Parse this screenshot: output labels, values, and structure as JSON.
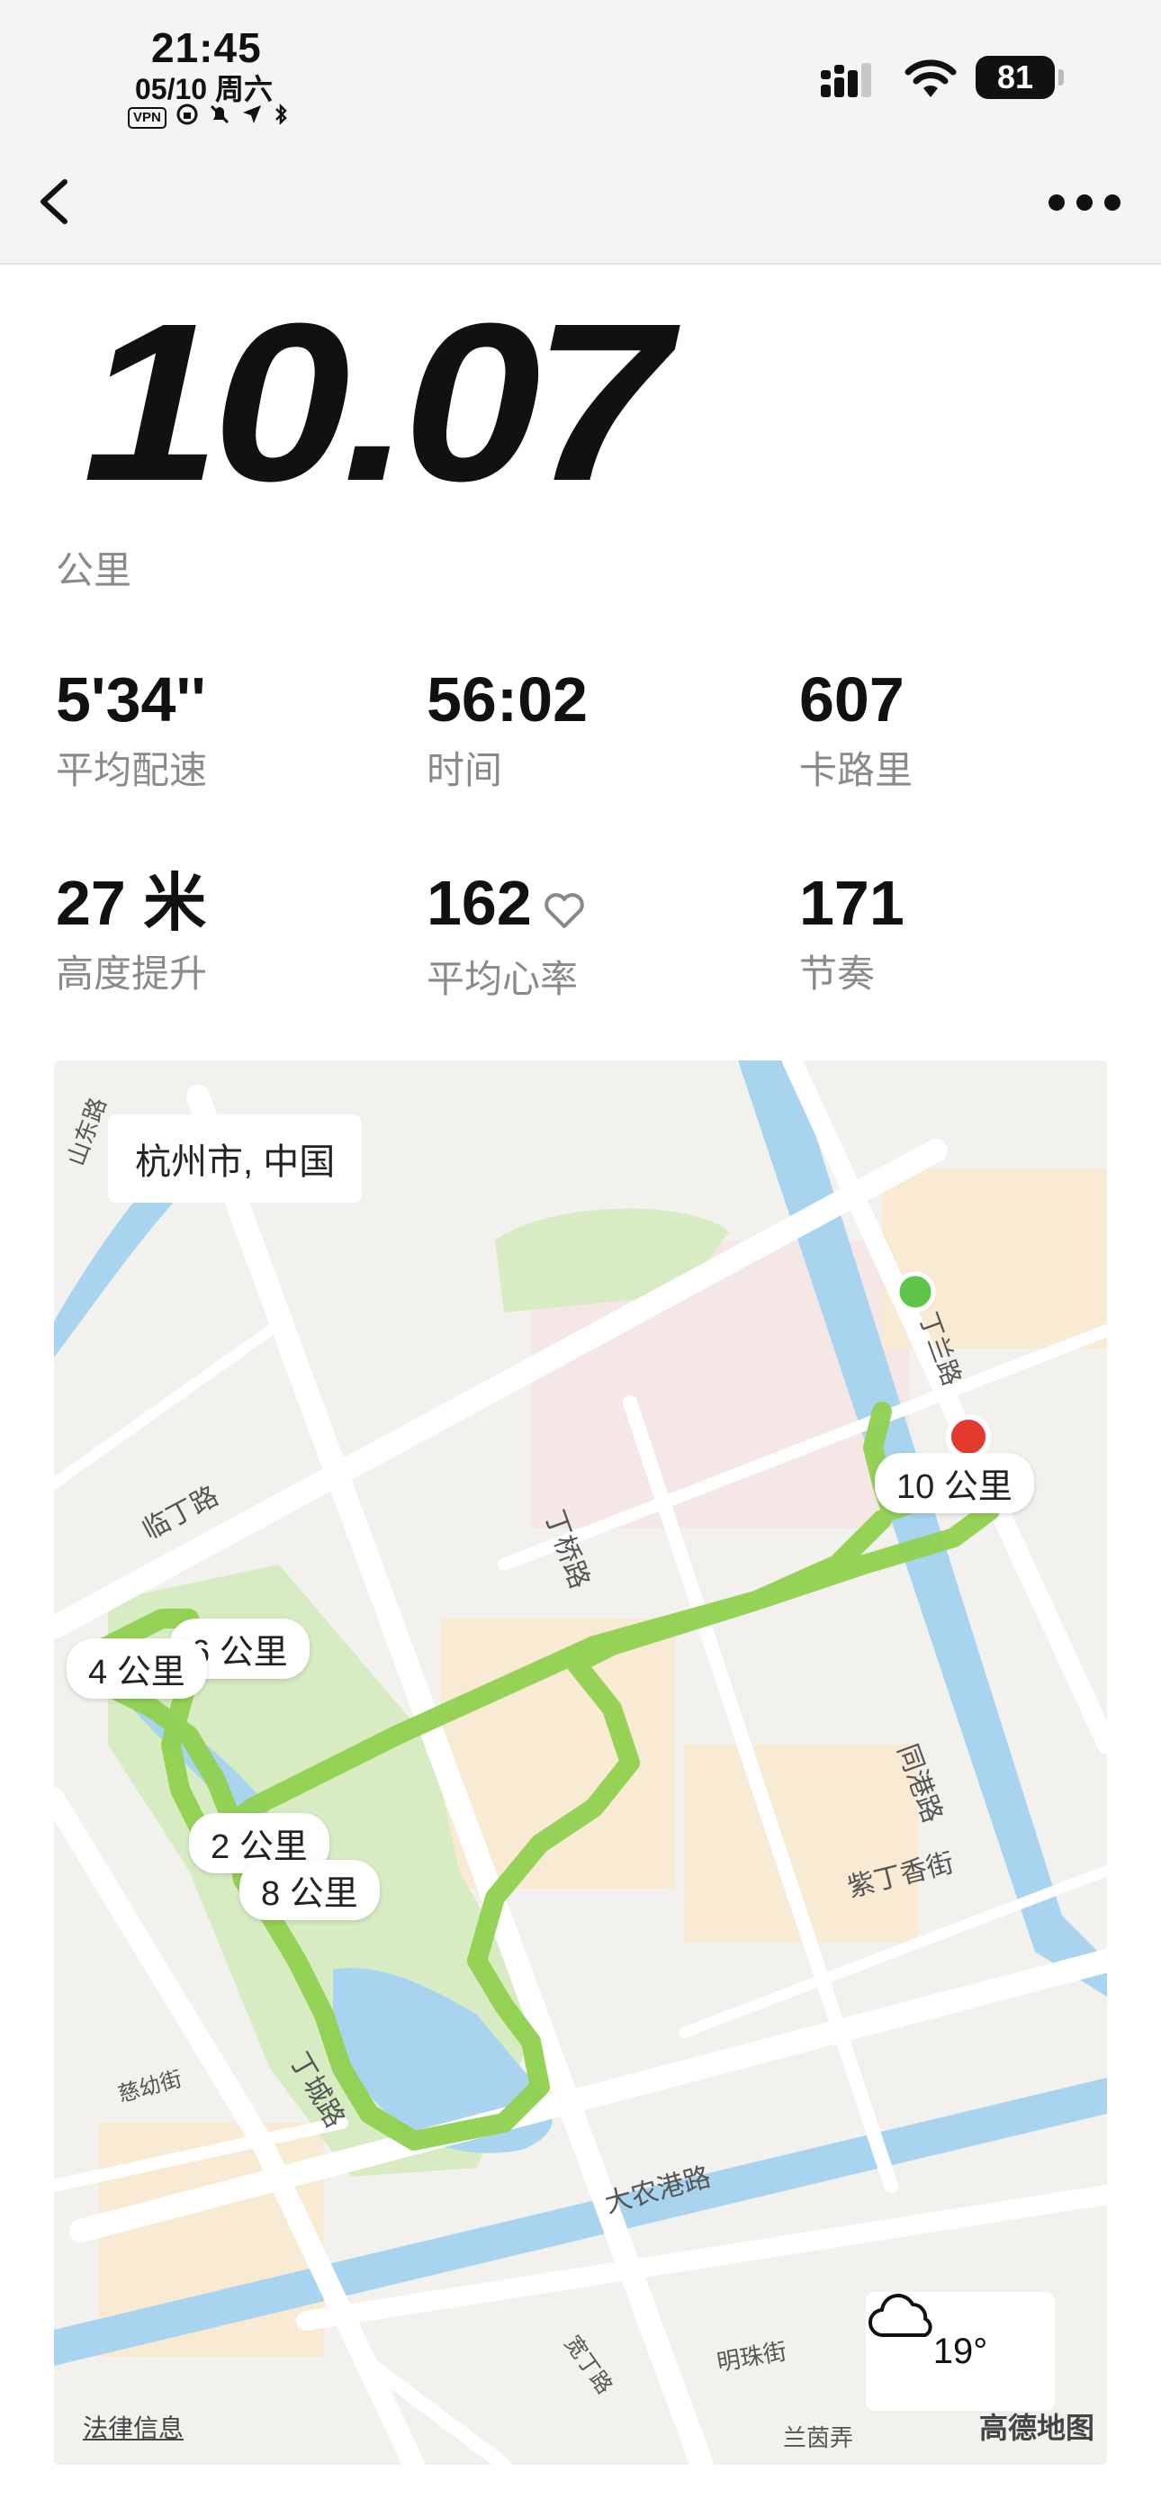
{
  "status_bar": {
    "time": "21:45",
    "date": "05/10 周六",
    "vpn": "VPN",
    "battery": "81"
  },
  "summary": {
    "distance": "10.07",
    "unit": "公里"
  },
  "stats": [
    {
      "value": "5'34''",
      "label": "平均配速"
    },
    {
      "value": "56:02",
      "label": "时间"
    },
    {
      "value": "607",
      "label": "卡路里"
    },
    {
      "value": "27 米",
      "label": "高度提升"
    },
    {
      "value": "162",
      "label": "平均心率"
    },
    {
      "value": "171",
      "label": "节奏"
    }
  ],
  "map": {
    "city": "杭州市, 中国",
    "km_markers": [
      "10 公里",
      "6 公里",
      "4 公里",
      "2 公里",
      "8 公里"
    ],
    "roads": [
      "丁桥路",
      "临丁路",
      "丁城路",
      "大农港路",
      "紫丁香街",
      "同港路",
      "慈幼街",
      "明珠街",
      "宽丁路",
      "兰茵弄",
      "山东路",
      "丁兰路"
    ],
    "weather": {
      "temp": "19°",
      "icon": "cloud-icon"
    },
    "legal": "法律信息",
    "provider": "高德地图"
  },
  "colors": {
    "route": "#8fd14f",
    "start": "#5ec44a",
    "end": "#e23b2e",
    "water": "#a9d4ef",
    "park": "#d8ecc4"
  }
}
